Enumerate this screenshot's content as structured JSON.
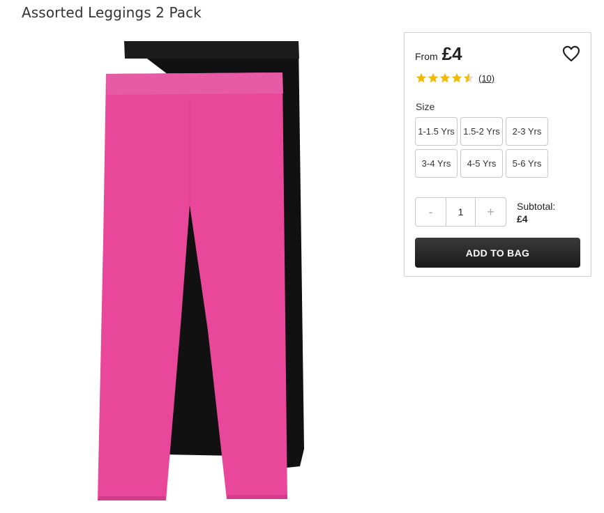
{
  "product": {
    "title": "Assorted Leggings 2 Pack",
    "image_alt": "Pink and black leggings"
  },
  "buy_box": {
    "from_label": "From",
    "price": "£4",
    "rating": {
      "stars": 4.5,
      "max": 5,
      "count_label": "(10)"
    },
    "size_label": "Size",
    "sizes": [
      "1-1.5 Yrs",
      "1.5-2 Yrs",
      "2-3 Yrs",
      "3-4 Yrs",
      "4-5 Yrs",
      "5-6 Yrs"
    ],
    "quantity": {
      "minus": "-",
      "value": "1",
      "plus": "+"
    },
    "subtotal_label": "Subtotal:",
    "subtotal_value": "£4",
    "add_to_bag": "ADD TO BAG"
  },
  "colors": {
    "star": "#f5b800",
    "pink": "#e8479a",
    "black": "#111111",
    "button": "#222222"
  }
}
